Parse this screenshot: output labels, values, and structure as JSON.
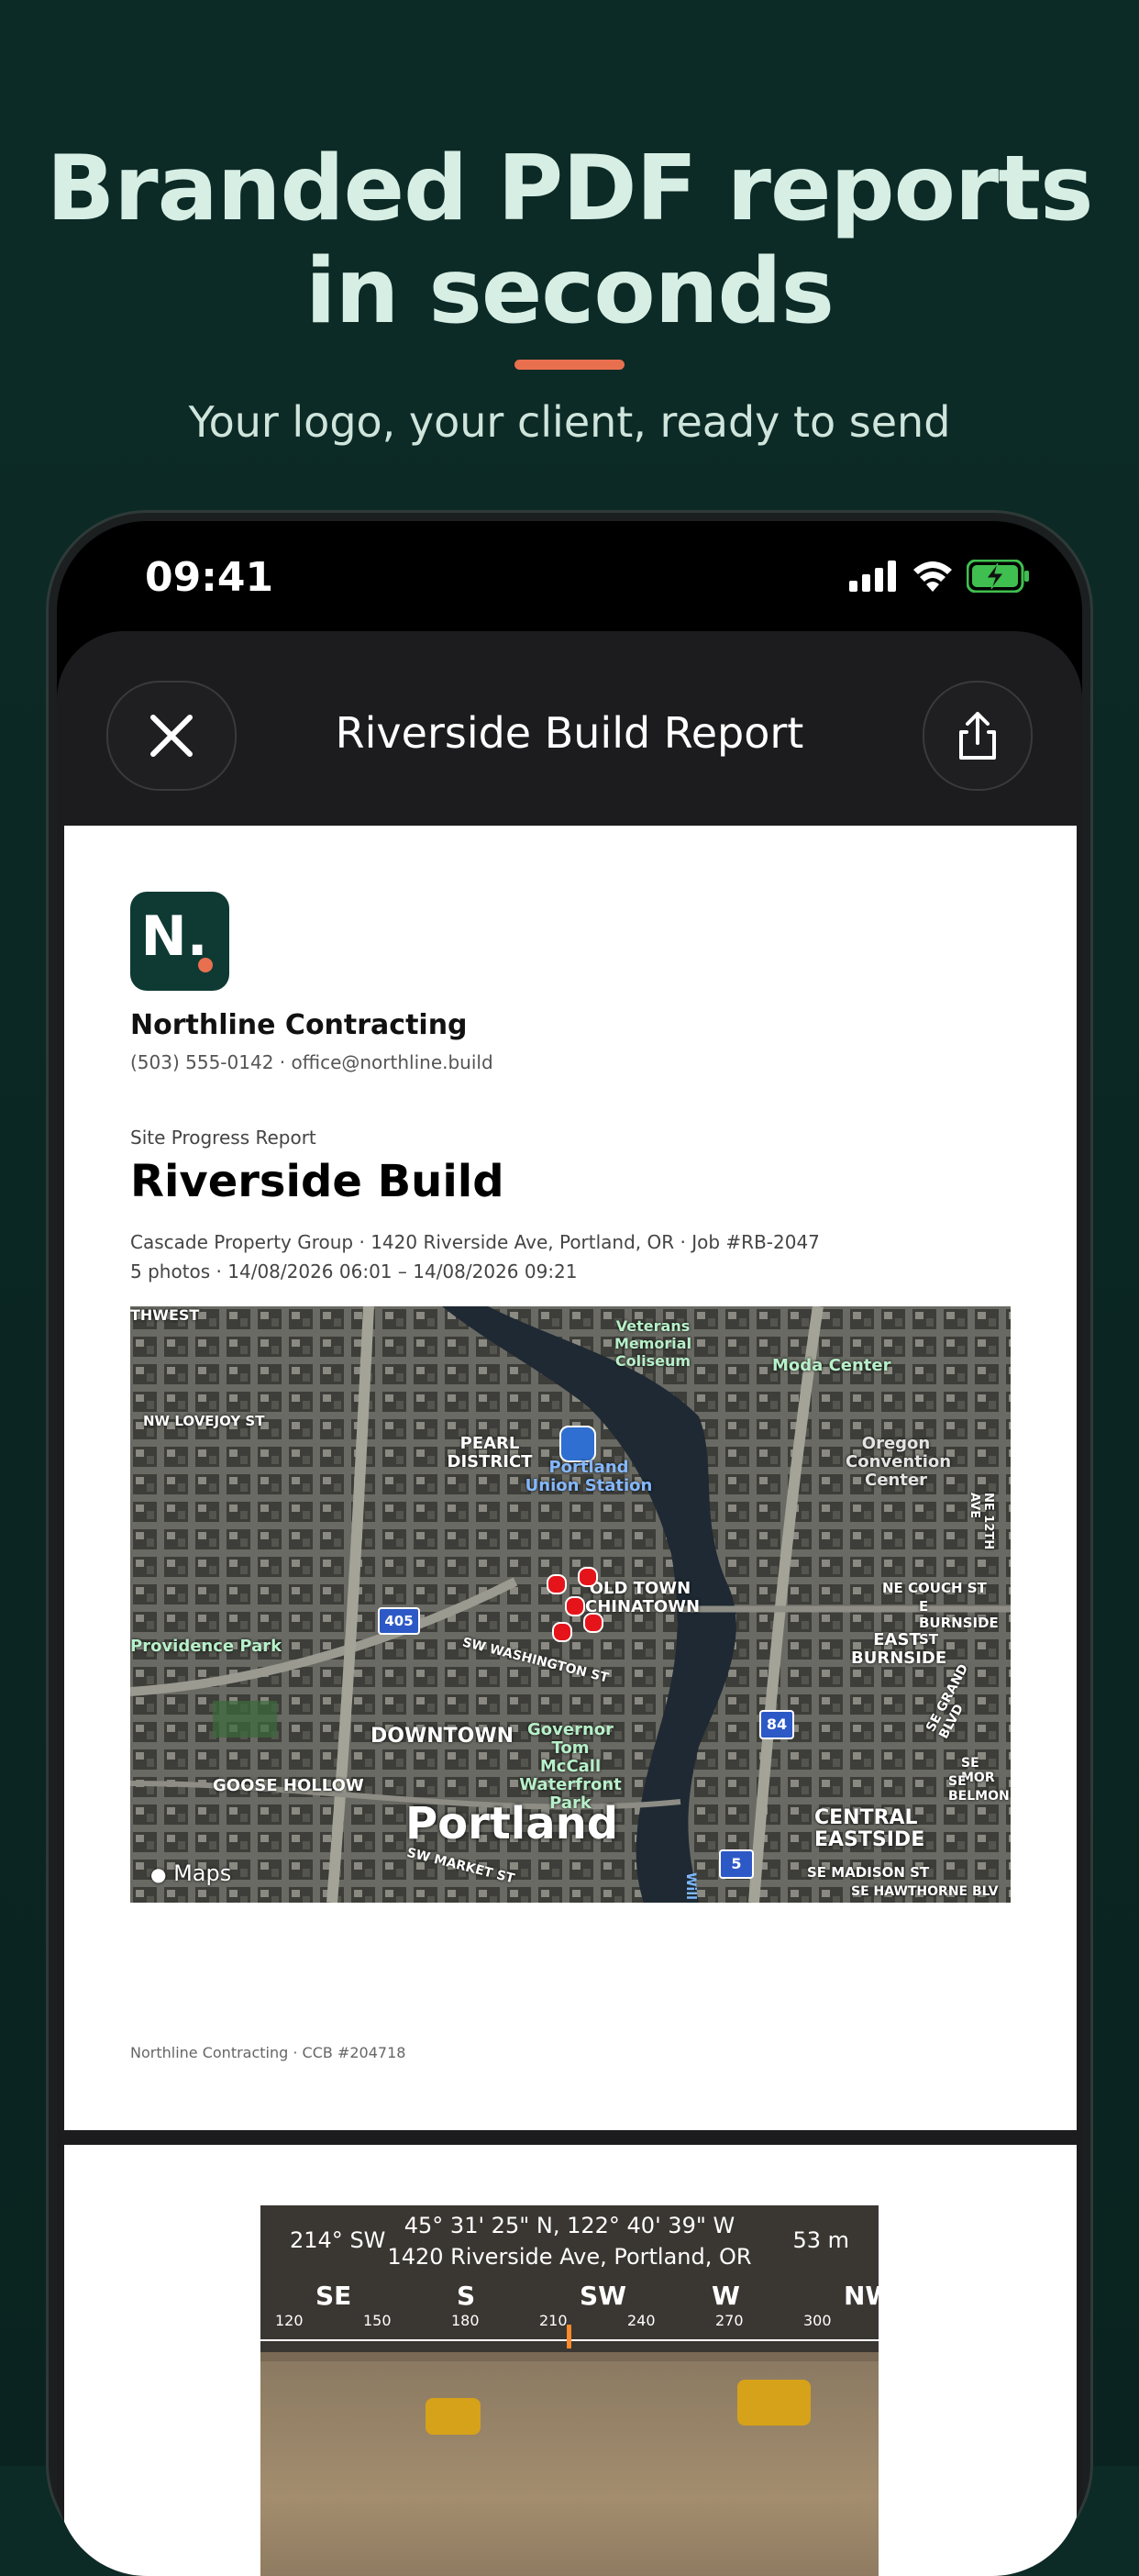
{
  "hero": {
    "headline": "Branded PDF reports in seconds",
    "subline": "Your logo, your client, ready to send",
    "accent_color": "#e8704f",
    "background_color": "#0c2a26"
  },
  "status_bar": {
    "time": "09:41",
    "icons": [
      "cellular-signal-icon",
      "wifi-icon",
      "battery-charging-icon"
    ]
  },
  "navbar": {
    "title": "Riverside Build Report",
    "close_icon": "close-icon",
    "share_icon": "share-icon"
  },
  "report": {
    "logo_letter": "N.",
    "company_name": "Northline Contracting",
    "company_contact": "(503) 555-0142 · office@northline.build",
    "doc_kicker": "Site Progress Report",
    "doc_title": "Riverside Build",
    "meta_line1": "Cascade Property Group  ·  1420 Riverside Ave, Portland, OR  ·  Job #RB-2047",
    "meta_line2": "5 photos  ·  14/08/2026 06:01 – 14/08/2026 09:21",
    "footer": "Northline Contracting · CCB #204718"
  },
  "map": {
    "brand": "Maps",
    "labels": {
      "northwest": "THWEST",
      "veterans": "Veterans",
      "memorial": "Memorial",
      "coliseum": "Coliseum",
      "moda": "Moda Center",
      "lovejoy": "NW LOVEJOY ST",
      "pearl1": "PEARL",
      "pearl2": "DISTRICT",
      "union1": "Portland",
      "union2": "Union Station",
      "oregon1": "Oregon",
      "oregon2": "Convention",
      "oregon3": "Center",
      "oldtown1": "OLD TOWN",
      "oldtown2": "CHINATOWN",
      "providence": "Providence Park",
      "i405": "405",
      "washington": "SW WASHINGTON ST",
      "ecouch": "NE COUCH ST",
      "eburnside": "E BURNSIDE ST",
      "eastburnside1": "EAST",
      "eastburnside2": "BURNSIDE",
      "downtown": "DOWNTOWN",
      "governor1": "Governor Tom",
      "governor2": "McCall",
      "governor3": "Waterfront Park",
      "i84": "84",
      "goosehollow": "GOOSE HOLLOW",
      "portland": "Portland",
      "centraleastside1": "CENTRAL",
      "centraleastside2": "EASTSIDE",
      "i5": "5",
      "market": "SW MARKET ST",
      "semadison": "SE MADISON ST",
      "sehawthorne": "SE HAWTHORNE BLV",
      "semor": "SE MOR",
      "sebelmon": "SE BELMON",
      "grandblvd": "SE GRAND BLVD",
      "ne12th": "NE 12TH AVE",
      "willamette": "Will"
    },
    "pin_color": "#e5141a"
  },
  "photo_overlay": {
    "heading": "214° SW",
    "coordinates": "45° 31' 25\" N, 122° 40' 39\" W",
    "address": "1420 Riverside Ave, Portland, OR",
    "altitude": "53 m",
    "compass_labels": [
      "SE",
      "S",
      "SW",
      "W",
      "NW"
    ],
    "compass_ticks": [
      "120",
      "150",
      "180",
      "210",
      "240",
      "270",
      "300"
    ]
  }
}
